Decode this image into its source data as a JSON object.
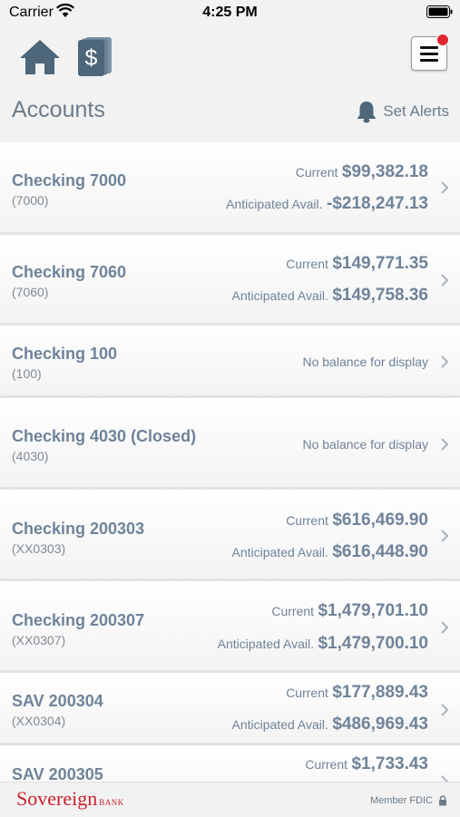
{
  "status_bar": {
    "carrier": "Carrier",
    "time": "4:25 PM"
  },
  "nav": {
    "home_icon": "home-icon",
    "bill_icon": "bill-pay-icon",
    "menu_icon": "hamburger-menu-icon"
  },
  "header": {
    "title": "Accounts",
    "alerts_label": "Set Alerts"
  },
  "accounts": [
    {
      "name": "Checking 7000",
      "number": "(7000)",
      "current_label": "Current",
      "current": "$99,382.18",
      "avail_label": "Anticipated Avail.",
      "avail": "-$218,247.13"
    },
    {
      "name": "Checking 7060",
      "number": "(7060)",
      "current_label": "Current",
      "current": "$149,771.35",
      "avail_label": "Anticipated Avail.",
      "avail": "$149,758.36"
    },
    {
      "name": "Checking 100",
      "number": "(100)",
      "no_balance": "No balance for display"
    },
    {
      "name": "Checking 4030 (Closed)",
      "number": "(4030)",
      "no_balance": "No balance for display"
    },
    {
      "name": "Checking 200303",
      "number": "(XX0303)",
      "current_label": "Current",
      "current": "$616,469.90",
      "avail_label": "Anticipated Avail.",
      "avail": "$616,448.90"
    },
    {
      "name": "Checking 200307",
      "number": "(XX0307)",
      "current_label": "Current",
      "current": "$1,479,701.10",
      "avail_label": "Anticipated Avail.",
      "avail": "$1,479,700.10"
    },
    {
      "name": "SAV 200304",
      "number": "(XX0304)",
      "current_label": "Current",
      "current": "$177,889.43",
      "avail_label": "Anticipated Avail.",
      "avail": "$486,969.43"
    },
    {
      "name": "SAV 200305",
      "number": "",
      "current_label": "Current",
      "current": "$1,733.43",
      "avail_label": "",
      "avail": ""
    }
  ],
  "footer": {
    "logo_main": "Sovereign",
    "logo_sub": "BANK",
    "member": "Member FDIC"
  },
  "colors": {
    "text_blue_gray": "#6f8399",
    "logo_red": "#c8202e",
    "badge_red": "#e0242f"
  }
}
